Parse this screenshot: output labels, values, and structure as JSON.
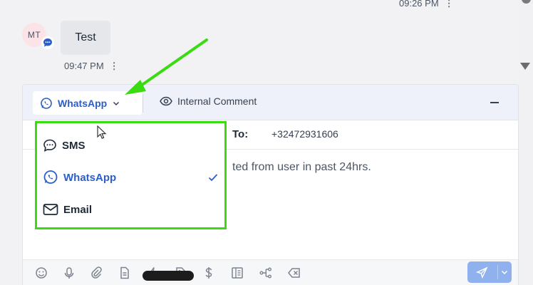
{
  "thread": {
    "previous_time": "09:26 PM",
    "avatar_initials": "MT",
    "message_text": "Test",
    "message_time": "09:47 PM"
  },
  "composer": {
    "channel_selected": "WhatsApp",
    "internal_comment_label": "Internal Comment",
    "to_label": "To:",
    "to_value": "+32472931606",
    "body_text": "ted from user in past 24hrs."
  },
  "channel_menu": {
    "items": [
      {
        "label": "SMS",
        "icon": "chat-bubble-icon",
        "selected": false
      },
      {
        "label": "WhatsApp",
        "icon": "whatsapp-icon",
        "selected": true
      },
      {
        "label": "Email",
        "icon": "envelope-icon",
        "selected": false
      }
    ]
  },
  "toolbar": {
    "icons": [
      "emoji-icon",
      "microphone-icon",
      "paperclip-icon",
      "document-icon",
      "lightning-icon",
      "tag-icon",
      "dollar-icon",
      "book-icon",
      "workflow-icon",
      "clear-icon"
    ]
  },
  "colors": {
    "accent": "#2b5fc7",
    "highlight": "#3bdb13",
    "send_button": "#8fb1ee"
  }
}
